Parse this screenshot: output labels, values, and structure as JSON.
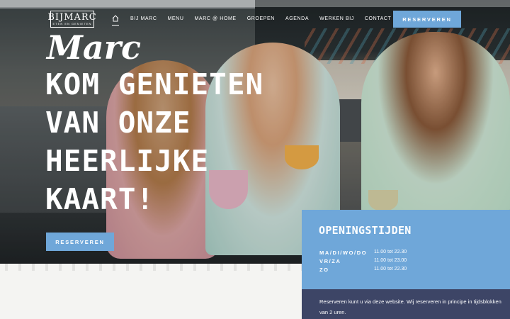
{
  "header": {
    "logo": {
      "main": "BIJMARC",
      "prefix": "BIJ",
      "name": "MARC",
      "sub": "ETEN EN GENIETEN"
    },
    "nav": [
      {
        "label": "BIJ MARC"
      },
      {
        "label": "MENU"
      },
      {
        "label": "MARC @ HOME"
      },
      {
        "label": "GROEPEN"
      },
      {
        "label": "AGENDA"
      },
      {
        "label": "WERKEN BIJ"
      },
      {
        "label": "CONTACT"
      }
    ],
    "reserve_label": "RESERVEREN"
  },
  "hero": {
    "script_title": "Marc",
    "headline": [
      "KOM GENIETEN",
      "VAN ONZE",
      "HEERLIJKE",
      "KAART!"
    ],
    "cta_label": "RESERVEREN"
  },
  "hours": {
    "title": "OPENINGSTIJDEN",
    "rows": [
      {
        "days": "MA/DI/WO/DO",
        "time": "11.00 tot 22.30"
      },
      {
        "days": "VR/ZA",
        "time": "11.00 tot 23.00"
      },
      {
        "days": "ZO",
        "time": "11.00 tot 22.30"
      }
    ]
  },
  "info": {
    "text": "Reserveren kunt u via deze website. Wij reserveren in principe in tijdsblokken van 2 uren."
  },
  "colors": {
    "accent": "#6fa7d9",
    "info_bg": "#3d4566"
  },
  "icons": {
    "home": "home-icon"
  }
}
